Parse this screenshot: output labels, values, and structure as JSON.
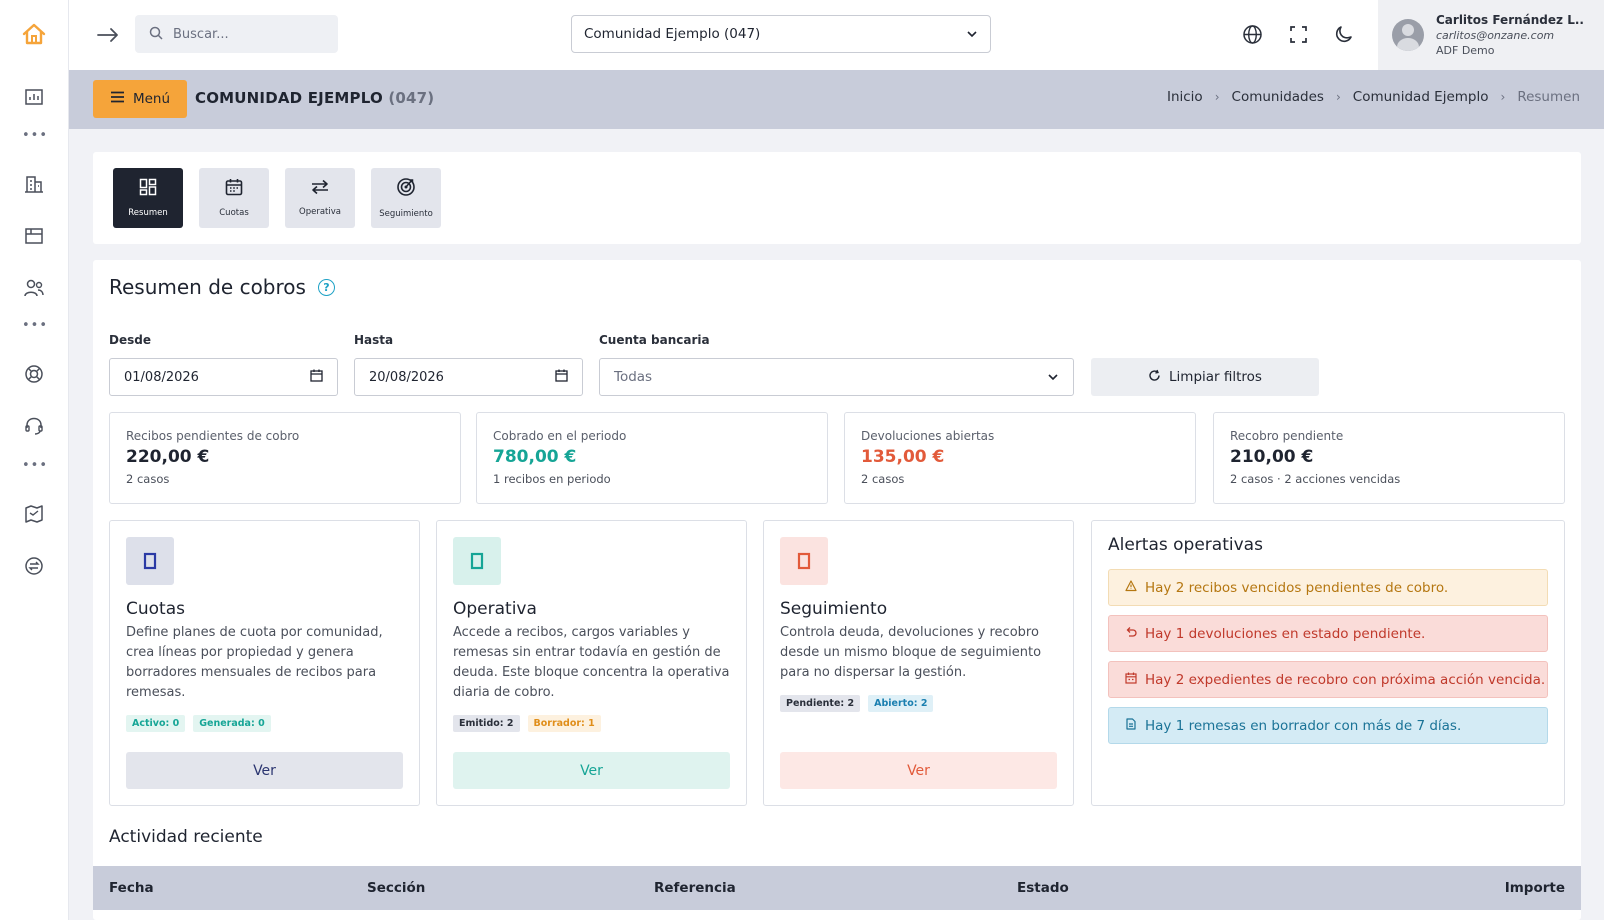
{
  "sidebar": {
    "items": [
      "home",
      "building-stats",
      "more",
      "buildings",
      "gallery",
      "users",
      "more",
      "support",
      "headset",
      "more",
      "map",
      "payments"
    ]
  },
  "topbar": {
    "search_placeholder": "Buscar...",
    "community": "Comunidad Ejemplo (047)",
    "user": {
      "name": "Carlitos Fernández L..",
      "email": "carlitos@onzane.com",
      "org": "ADF Demo"
    }
  },
  "header": {
    "menu_label": "Menú",
    "title": "COMUNIDAD EJEMPLO",
    "title_code": "(047)",
    "breadcrumb": [
      "Inicio",
      "Comunidades",
      "Comunidad Ejemplo",
      "Resumen"
    ]
  },
  "tabs": [
    {
      "label": "Resumen",
      "icon": "dashboard-icon",
      "active": true
    },
    {
      "label": "Cuotas",
      "icon": "calendar-icon",
      "active": false
    },
    {
      "label": "Operativa",
      "icon": "swap-icon",
      "active": false
    },
    {
      "label": "Seguimiento",
      "icon": "target-icon",
      "active": false
    }
  ],
  "summary": {
    "title": "Resumen de cobros",
    "filters": {
      "desde_label": "Desde",
      "desde_value": "01/08/2026",
      "hasta_label": "Hasta",
      "hasta_value": "20/08/2026",
      "cuenta_label": "Cuenta bancaria",
      "cuenta_value": "Todas",
      "clear_label": "Limpiar filtros"
    },
    "stats": [
      {
        "label": "Recibos pendientes de cobro",
        "value": "220,00 €",
        "sub": "2 casos"
      },
      {
        "label": "Cobrado en el periodo",
        "value": "780,00 €",
        "sub": "1 recibos en periodo"
      },
      {
        "label": "Devoluciones abiertas",
        "value": "135,00 €",
        "sub": "2 casos"
      },
      {
        "label": "Recobro pendiente",
        "value": "210,00 €",
        "sub": "2 casos · 2 acciones vencidas"
      }
    ],
    "features": [
      {
        "title": "Cuotas",
        "desc": "Define planes de cuota por comunidad, crea líneas por propiedad y genera borradores mensuales de recibos para remesas.",
        "badges": [
          "Activo: 0",
          "Generada: 0"
        ],
        "button": "Ver"
      },
      {
        "title": "Operativa",
        "desc": "Accede a recibos, cargos variables y remesas sin entrar todavía en gestión de deuda. Este bloque concentra la operativa diaria de cobro.",
        "badges": [
          "Emitido: 2",
          "Borrador: 1"
        ],
        "button": "Ver"
      },
      {
        "title": "Seguimiento",
        "desc": "Controla deuda, devoluciones y recobro desde un mismo bloque de seguimiento para no dispersar la gestión.",
        "badges": [
          "Pendiente: 2",
          "Abierto: 2"
        ],
        "button": "Ver"
      }
    ],
    "alerts": {
      "title": "Alertas operativas",
      "items": [
        "Hay 2 recibos vencidos pendientes de cobro.",
        "Hay 1 devoluciones en estado pendiente.",
        "Hay 2 expedientes de recobro con próxima acción vencida.",
        "Hay 1 remesas en borrador con más de 7 días."
      ]
    },
    "activity": {
      "title": "Actividad reciente",
      "columns": [
        "Fecha",
        "Sección",
        "Referencia",
        "Estado",
        "Importe"
      ]
    }
  },
  "colors": {
    "accent": "#f5a43a",
    "dark": "#1f2430",
    "green": "#16a596",
    "red": "#e25a3a",
    "header_band": "#c8ccda"
  }
}
